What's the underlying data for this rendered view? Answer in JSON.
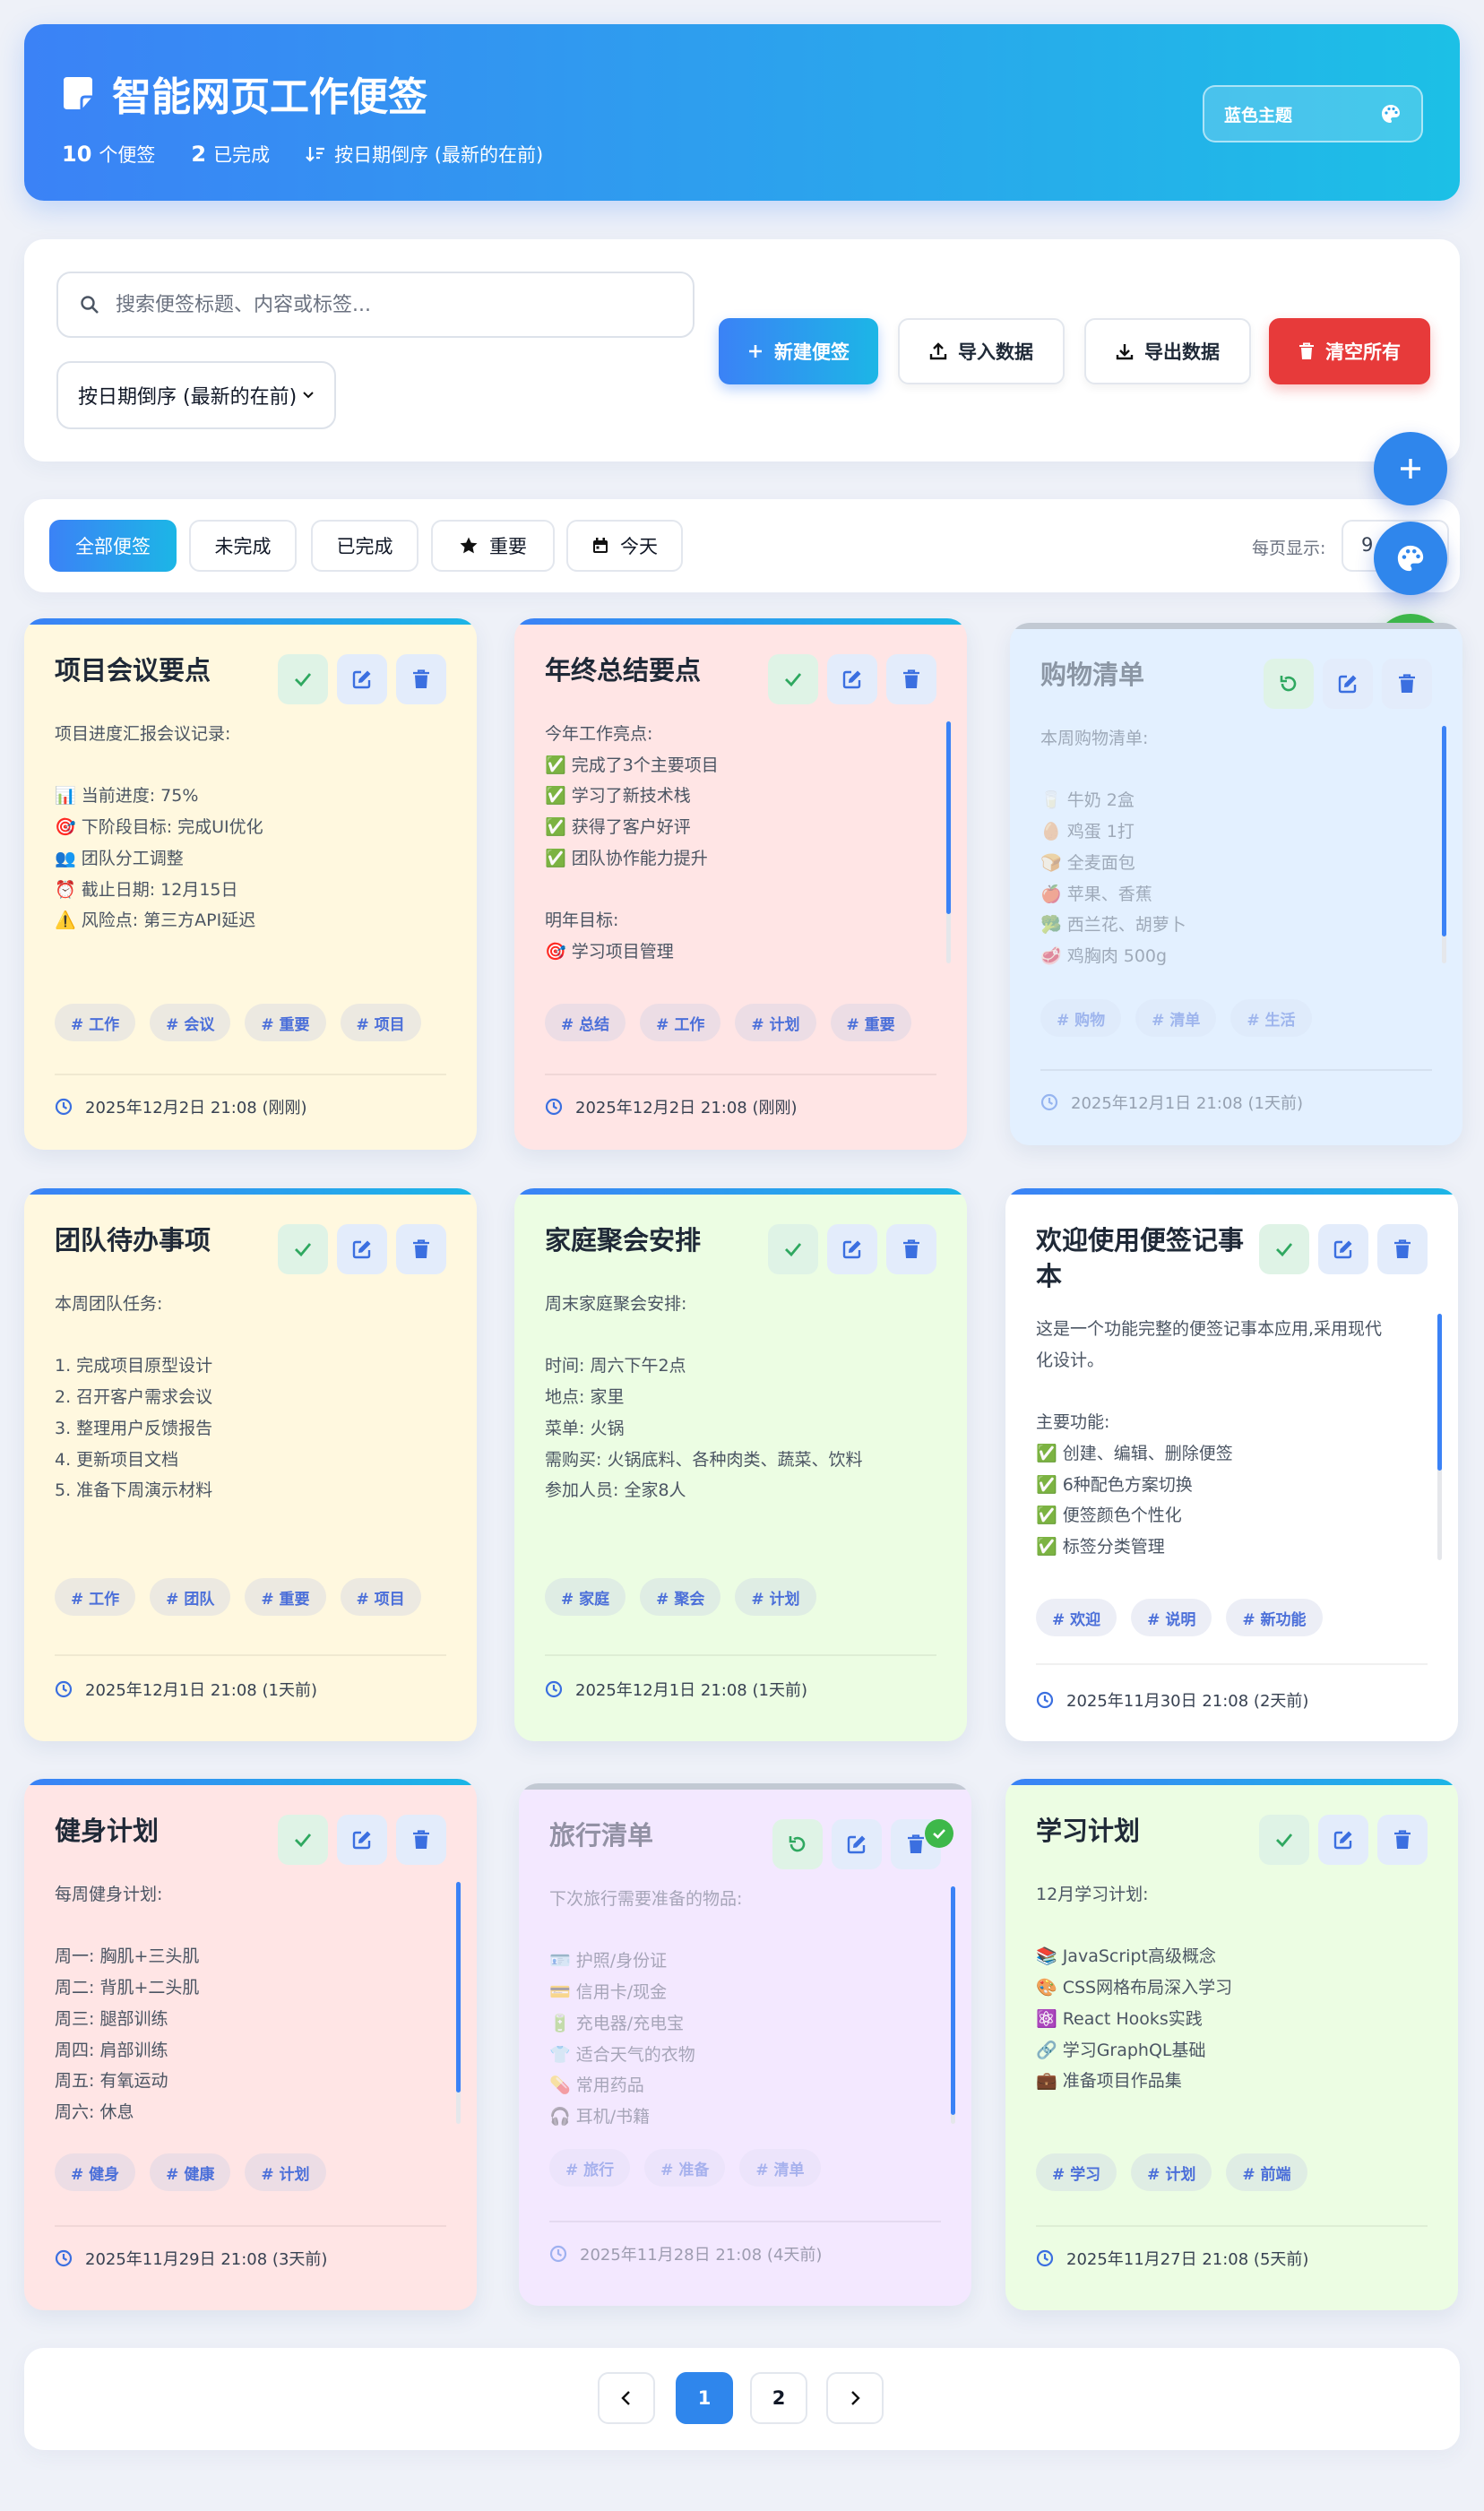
{
  "header": {
    "title": "智能网页工作便签",
    "count_number": "10",
    "count_label": "个便签",
    "done_number": "2",
    "done_label": "已完成",
    "sort_label": "按日期倒序 (最新的在前)",
    "theme_label": "蓝色主题"
  },
  "toolbar": {
    "search_placeholder": "搜索便签标题、内容或标签...",
    "sort_value": "按日期倒序 (最新的在前)",
    "new_label": "新建便签",
    "import_label": "导入数据",
    "export_label": "导出数据",
    "clear_label": "清空所有"
  },
  "filters": {
    "all": "全部便签",
    "pending": "未完成",
    "done": "已完成",
    "important": "重要",
    "today": "今天",
    "perpage_label": "每页显示:",
    "perpage_value": "9"
  },
  "colors": {
    "accent": "#3b82f6",
    "accent2": "#1cb6e6",
    "danger": "#e73a3a",
    "success": "#3db84a"
  },
  "cards": [
    {
      "title": "项目会议要点",
      "body": "项目进度汇报会议记录:\n\n📊 当前进度: 75%\n🎯 下阶段目标: 完成UI优化\n👥 团队分工调整\n⏰ 截止日期: 12月15日\n⚠️ 风险点: 第三方API延迟",
      "tags": [
        "# 工作",
        "# 会议",
        "# 重要",
        "# 项目"
      ],
      "date": "2025年12月2日 21:08 (刚刚)",
      "bg": "#fff8df",
      "done": false
    },
    {
      "title": "年终总结要点",
      "body": "今年工作亮点:\n✅ 完成了3个主要项目\n✅ 学习了新技术栈\n✅ 获得了客户好评\n✅ 团队协作能力提升\n\n明年目标:\n🎯 学习项目管理",
      "tags": [
        "# 总结",
        "# 工作",
        "# 计划",
        "# 重要"
      ],
      "date": "2025年12月2日 21:08 (刚刚)",
      "bg": "#ffe5e5",
      "done": false
    },
    {
      "title": "购物清单",
      "body": "本周购物清单:\n\n🥛 牛奶 2盒\n🥚 鸡蛋 1打\n🍞 全麦面包\n🍎 苹果、香蕉\n🥦 西兰花、胡萝卜\n🥩 鸡胸肉 500g",
      "tags": [
        "# 购物",
        "# 清单",
        "# 生活"
      ],
      "date": "2025年12月1日 21:08 (1天前)",
      "bg": "#e3f0ff",
      "done": true
    },
    {
      "title": "团队待办事项",
      "body": "本周团队任务:\n\n1. 完成项目原型设计\n2. 召开客户需求会议\n3. 整理用户反馈报告\n4. 更新项目文档\n5. 准备下周演示材料",
      "tags": [
        "# 工作",
        "# 团队",
        "# 重要",
        "# 项目"
      ],
      "date": "2025年12月1日 21:08 (1天前)",
      "bg": "#fff8df",
      "done": false
    },
    {
      "title": "家庭聚会安排",
      "body": "周末家庭聚会安排:\n\n时间: 周六下午2点\n地点: 家里\n菜单: 火锅\n需购买: 火锅底料、各种肉类、蔬菜、饮料\n参加人员: 全家8人",
      "tags": [
        "# 家庭",
        "# 聚会",
        "# 计划"
      ],
      "date": "2025年12月1日 21:08 (1天前)",
      "bg": "#ecfde3",
      "done": false
    },
    {
      "title": "欢迎使用便签记事本",
      "body": "这是一个功能完整的便签记事本应用,采用现代\n化设计。\n\n主要功能:\n✅ 创建、编辑、删除便签\n✅ 6种配色方案切换\n✅ 便签颜色个性化\n✅ 标签分类管理",
      "tags": [
        "# 欢迎",
        "# 说明",
        "# 新功能"
      ],
      "date": "2025年11月30日 21:08 (2天前)",
      "bg": "#ffffff",
      "done": false
    },
    {
      "title": "健身计划",
      "body": "每周健身计划:\n\n周一: 胸肌+三头肌\n周二: 背肌+二头肌\n周三: 腿部训练\n周四: 肩部训练\n周五: 有氧运动\n周六: 休息",
      "tags": [
        "# 健身",
        "# 健康",
        "# 计划"
      ],
      "date": "2025年11月29日 21:08 (3天前)",
      "bg": "#ffe5e5",
      "done": false
    },
    {
      "title": "旅行清单",
      "body": "下次旅行需要准备的物品:\n\n🪪 护照/身份证\n💳 信用卡/现金\n🔋 充电器/充电宝\n👕 适合天气的衣物\n💊 常用药品\n🎧 耳机/书籍",
      "tags": [
        "# 旅行",
        "# 准备",
        "# 清单"
      ],
      "date": "2025年11月28日 21:08 (4天前)",
      "bg": "#f3e8ff",
      "done": true
    },
    {
      "title": "学习计划",
      "body": "12月学习计划:\n\n📚 JavaScript高级概念\n🎨 CSS网格布局深入学习\n⚛️ React Hooks实践\n🔗 学习GraphQL基础\n💼 准备项目作品集",
      "tags": [
        "# 学习",
        "# 计划",
        "# 前端"
      ],
      "date": "2025年11月27日 21:08 (5天前)",
      "bg": "#ecfde3",
      "done": false
    }
  ],
  "pagination": {
    "pages": [
      "1",
      "2"
    ],
    "current": "1"
  }
}
